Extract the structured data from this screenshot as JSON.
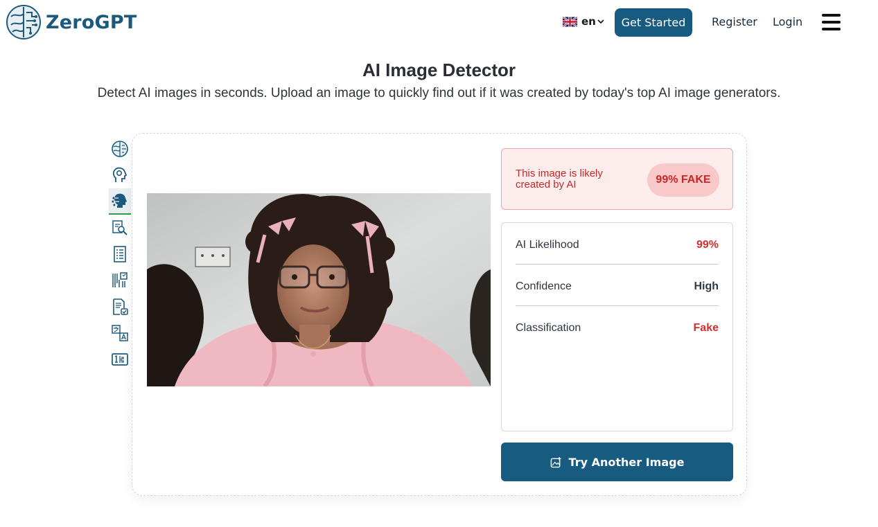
{
  "header": {
    "brand": "ZeroGPT",
    "language": "en",
    "get_started_label": "Get Started",
    "register_label": "Register",
    "login_label": "Login"
  },
  "page": {
    "title": "AI Image Detector",
    "subtitle": "Detect AI images in seconds. Upload an image to quickly find out if it was created by today's top AI image generators."
  },
  "tools": [
    {
      "icon": "brain-icon",
      "active": false
    },
    {
      "icon": "head-gear-icon",
      "active": false
    },
    {
      "icon": "ai-face-icon",
      "active": true
    },
    {
      "icon": "document-search-icon",
      "active": false
    },
    {
      "icon": "document-list-icon",
      "active": false
    },
    {
      "icon": "paraphrase-icon",
      "active": false
    },
    {
      "icon": "document-check-icon",
      "active": false
    },
    {
      "icon": "translate-icon",
      "active": false
    },
    {
      "icon": "word-counter-icon",
      "active": false
    }
  ],
  "result": {
    "verdict_text": "This image is likely created by AI",
    "badge": "99% FAKE",
    "stats": [
      {
        "label": "AI Likelihood",
        "value": "99%",
        "color": "#d32f2f"
      },
      {
        "label": "Confidence",
        "value": "High",
        "color": "#2f3b4a"
      },
      {
        "label": "Classification",
        "value": "Fake",
        "color": "#d32f2f"
      }
    ],
    "try_button_label": "Try Another Image"
  },
  "colors": {
    "brand": "#175b80",
    "danger": "#c62828",
    "active_indicator": "#2e9c4c"
  }
}
